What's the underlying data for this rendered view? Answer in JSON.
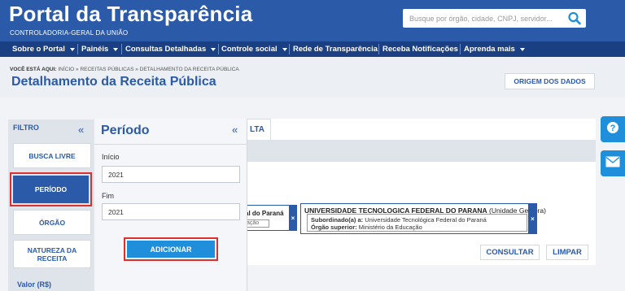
{
  "header": {
    "title": "Portal da Transparência",
    "subtitle": "CONTROLADORIA-GERAL DA UNIÃO",
    "search": {
      "placeholder": "Busque por órgão, cidade, CNPJ, servidor..."
    }
  },
  "nav": {
    "items": [
      {
        "label": "Sobre o Portal",
        "dropdown": true
      },
      {
        "label": "Painéis",
        "dropdown": true
      },
      {
        "label": "Consultas Detalhadas",
        "dropdown": true
      },
      {
        "label": "Controle social",
        "dropdown": true
      },
      {
        "label": "Rede de Transparência",
        "dropdown": false
      },
      {
        "label": "Receba Notificações",
        "dropdown": false
      },
      {
        "label": "Aprenda mais",
        "dropdown": true
      }
    ]
  },
  "breadcrumb": {
    "prefix": "VOCÊ ESTÁ AQUI:",
    "path": "INÍCIO » RECEITAS PÚBLICAS » DETALHAMENTO DA RECEITA PÚBLICA"
  },
  "page_title": "Detalhamento da Receita Pública",
  "origin_button": "ORIGEM DOS DADOS",
  "filter": {
    "title": "FILTRO",
    "collapse_icon": "«",
    "items": {
      "busca": "BUSCA LIVRE",
      "periodo": "PERÍODO",
      "orgao": "ÓRGÃO",
      "natureza": "NATUREZA DA RECEITA",
      "valor": "Valor (R$)"
    }
  },
  "periodo_panel": {
    "title": "Período",
    "collapse_icon": "«",
    "inicio_label": "Início",
    "inicio_value": "2021",
    "fim_label": "Fim",
    "fim_value": "2021",
    "add_button": "ADICIONAR"
  },
  "main": {
    "tab_label": "LTA",
    "chip1": {
      "title": "al do Paraná",
      "tag": "ação",
      "close": "×"
    },
    "chip2": {
      "title": "UNIVERSIDADE TECNOLOGICA FEDERAL DO PARANA",
      "kind": "(Unidade Gestora)",
      "sub_label": "Subordinado(a) a:",
      "sub_value": "Universidade Tecnológica Federal do Paraná",
      "org_label": "Órgão superior:",
      "org_value": "Ministério da Educação",
      "close": "×"
    },
    "consultar": "CONSULTAR",
    "limpar": "LIMPAR"
  },
  "colors": {
    "brand_blue": "#2b5aa8",
    "nav_blue": "#1a3f82",
    "accent_blue": "#1f8fdb",
    "highlight_red": "#d93030"
  },
  "icons": {
    "search": "search-icon",
    "help": "question-icon",
    "mail": "envelope-icon"
  }
}
